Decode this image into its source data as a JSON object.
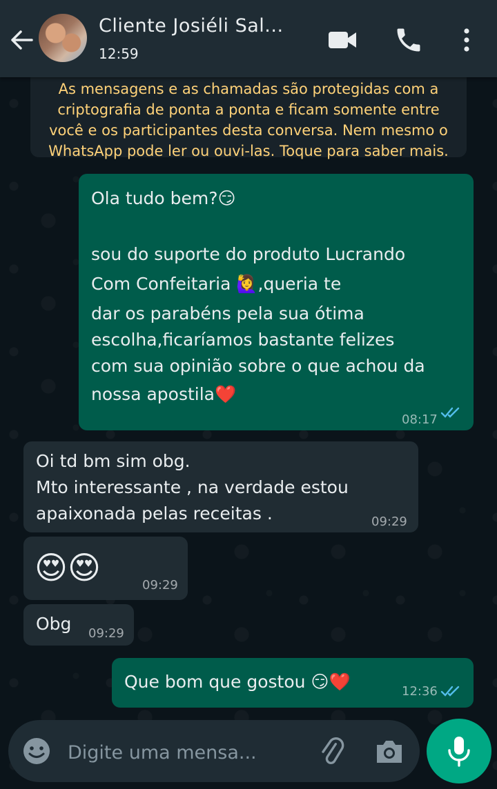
{
  "header": {
    "contact_name": "Cliente Josiéli Sal...",
    "status": "12:59"
  },
  "notice": {
    "lines": [
      "As mensagens e as chamadas são protegidas com a",
      "criptografia de ponta a ponta e ficam somente entre",
      "você e os participantes desta conversa. Nem mesmo o",
      "WhatsApp pode ler ou ouvi-las. Toque para saber mais."
    ]
  },
  "messages": [
    {
      "direction": "outgoing",
      "lines": [
        "Ola tudo bem?😏",
        "",
        "sou do suporte do produto Lucrando",
        "Com Confeitaria 🙋‍♀️,queria te",
        "dar os parabéns pela sua ótima",
        "escolha,ficaríamos bastante felizes",
        "com sua opinião sobre o que achou da",
        "nossa apostila❤️"
      ],
      "time": "08:17",
      "status": "read"
    },
    {
      "direction": "incoming",
      "lines": [
        "Oi td bm sim obg.",
        "Mto interessante , na verdade estou",
        "apaixonada pelas receitas ."
      ],
      "time": "09:29"
    },
    {
      "direction": "incoming",
      "lines": [
        "😍😍"
      ],
      "time": "09:29"
    },
    {
      "direction": "incoming",
      "lines": [
        "Obg"
      ],
      "time": "09:29"
    },
    {
      "direction": "outgoing",
      "lines": [
        "Que bom que gostou 😏❤️"
      ],
      "time": "12:36",
      "status": "read"
    }
  ],
  "input": {
    "placeholder": "Digite uma mensa..."
  },
  "colors": {
    "header_bg": "#1f2c34",
    "chat_bg": "#0b141a",
    "outgoing_bubble": "#005c4b",
    "incoming_bubble": "#202c33",
    "notice_text": "#ffd279",
    "read_ticks": "#53bdeb",
    "accent": "#00a884"
  },
  "icons": {
    "back": "arrow-left-icon",
    "video": "video-camera-icon",
    "call": "phone-icon",
    "menu": "more-vertical-icon",
    "emoji": "emoji-icon",
    "attach": "paperclip-icon",
    "camera": "camera-icon",
    "mic": "microphone-icon"
  }
}
